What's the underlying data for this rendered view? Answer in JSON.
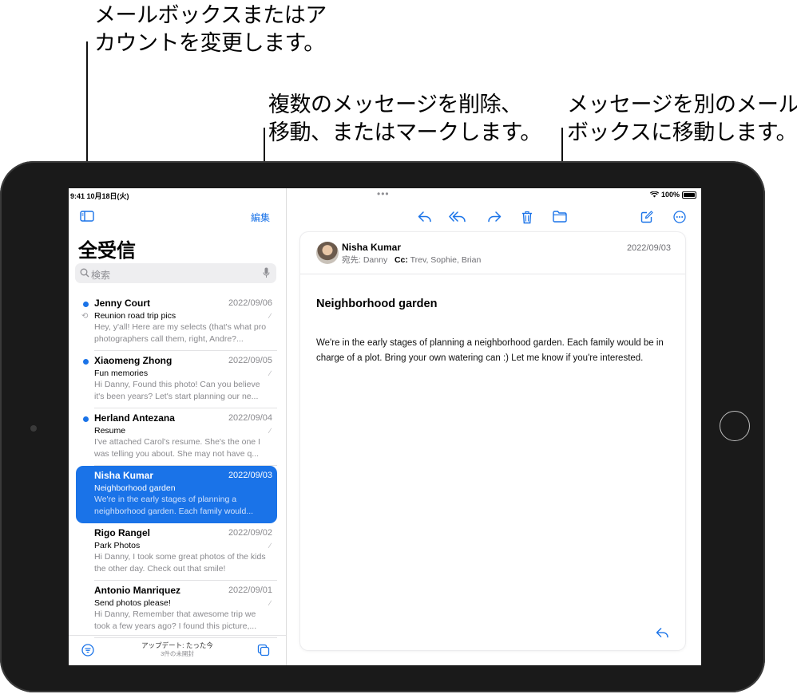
{
  "callouts": {
    "mailbox": [
      "メールボックスまたはア",
      "カウントを変更します。"
    ],
    "edit": [
      "複数のメッセージを削除、",
      "移動、またはマークします。"
    ],
    "move": [
      "メッセージを別のメール",
      "ボックスに移動します。"
    ]
  },
  "status_bar": {
    "time": "9:41",
    "date": "10月18日(火)",
    "battery": "100%",
    "multitask_dots": "•••"
  },
  "sidebar": {
    "edit_label": "編集",
    "title": "全受信",
    "search_placeholder": "検索",
    "footer_updated": "アップデート: たった今",
    "footer_unread": "3件の未開封"
  },
  "mails": [
    {
      "from": "Jenny Court",
      "date": "2022/09/06",
      "subject": "Reunion road trip pics",
      "preview": "Hey, y'all! Here are my selects (that's what pro photographers call them, right, Andre?...",
      "unread": true,
      "replied": true
    },
    {
      "from": "Xiaomeng Zhong",
      "date": "2022/09/05",
      "subject": "Fun memories",
      "preview": "Hi Danny, Found this photo! Can you believe it's been years? Let's start planning our ne...",
      "unread": true,
      "replied": false
    },
    {
      "from": "Herland Antezana",
      "date": "2022/09/04",
      "subject": "Resume",
      "preview": "I've attached Carol's resume. She's the one I was telling you about. She may not have q...",
      "unread": true,
      "replied": false
    },
    {
      "from": "Nisha Kumar",
      "date": "2022/09/03",
      "subject": "Neighborhood garden",
      "preview": "We're in the early stages of planning a neighborhood garden. Each family would...",
      "unread": false,
      "replied": false,
      "selected": true
    },
    {
      "from": "Rigo Rangel",
      "date": "2022/09/02",
      "subject": "Park Photos",
      "preview": "Hi Danny, I took some great photos of the kids the other day. Check out that smile!",
      "unread": false,
      "replied": false
    },
    {
      "from": "Antonio Manriquez",
      "date": "2022/09/01",
      "subject": "Send photos please!",
      "preview": "Hi Danny, Remember that awesome trip we took a few years ago? I found this picture,...",
      "unread": false,
      "replied": false
    }
  ],
  "message": {
    "sender": "Nisha Kumar",
    "to_label": "宛先:",
    "to": "Danny",
    "cc_label": "Cc:",
    "cc": "Trev, Sophie, Brian",
    "date": "2022/09/03",
    "subject": "Neighborhood garden",
    "body": "We're in the early stages of planning a neighborhood garden. Each family would be in charge of a plot. Bring your own watering can :) Let me know if you're interested."
  },
  "colors": {
    "accent": "#1a73e8",
    "device": "#1a1a1a"
  },
  "icons": {
    "sidebar": "sidebar-toggle-icon",
    "reply": "reply-icon",
    "reply_all": "reply-all-icon",
    "forward": "forward-icon",
    "trash": "trash-icon",
    "folder": "folder-icon",
    "compose": "compose-icon",
    "more": "more-icon"
  }
}
